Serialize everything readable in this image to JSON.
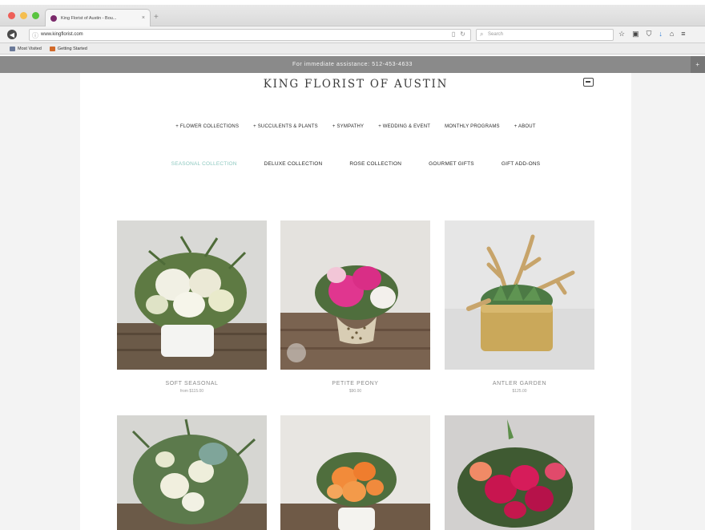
{
  "browser": {
    "tab_title": "King Florist of Austin - Bou...",
    "tab_close": "×",
    "new_tab": "+",
    "url": "www.kingflorist.com",
    "search_placeholder": "Search",
    "bookmarks": [
      "Most Visited",
      "Getting Started"
    ]
  },
  "announcement": "For immediate assistance: 512-453-4633",
  "site": {
    "logo": "KING FLORIST OF AUSTIN",
    "main_nav": [
      "+ FLOWER COLLECTIONS",
      "+ SUCCULENTS & PLANTS",
      "+ SYMPATHY",
      "+ WEDDING & EVENT",
      "MONTHLY PROGRAMS",
      "+ ABOUT"
    ],
    "sub_nav": [
      "SEASONAL COLLECTION",
      "DELUXE COLLECTION",
      "ROSE COLLECTION",
      "GOURMET GIFTS",
      "GIFT ADD-ONS"
    ]
  },
  "products": [
    {
      "name": "SOFT SEASONAL",
      "price": "from $115.00"
    },
    {
      "name": "PETITE PEONY",
      "price": "$90.00"
    },
    {
      "name": "ANTLER GARDEN",
      "price": "$125.00"
    },
    {
      "name": "",
      "price": ""
    },
    {
      "name": "",
      "price": ""
    },
    {
      "name": "",
      "price": ""
    }
  ],
  "colors": {
    "active_subnav": "#8ec9c0",
    "announcement_bar": "#8a8a8a",
    "traffic_red": "#ee5f58",
    "traffic_yellow": "#f5be4f",
    "traffic_green": "#59c43f"
  }
}
